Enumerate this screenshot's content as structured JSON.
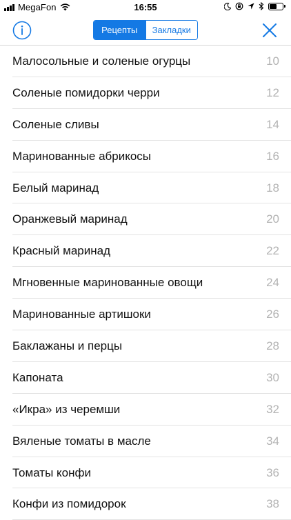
{
  "status_bar": {
    "carrier": "MegaFon",
    "time": "16:55"
  },
  "nav": {
    "info_icon": "info-circle-icon",
    "segments": [
      {
        "label": "Рецепты",
        "selected": true
      },
      {
        "label": "Закладки",
        "selected": false
      }
    ],
    "close_icon": "close-x-icon",
    "accent_color": "#1479e4"
  },
  "recipes": [
    {
      "title": "Малосольные и соленые огурцы",
      "page": "10"
    },
    {
      "title": "Соленые помидорки черри",
      "page": "12"
    },
    {
      "title": "Соленые сливы",
      "page": "14"
    },
    {
      "title": "Маринованные абрикосы",
      "page": "16"
    },
    {
      "title": "Белый маринад",
      "page": "18"
    },
    {
      "title": "Оранжевый маринад",
      "page": "20"
    },
    {
      "title": "Красный маринад",
      "page": "22"
    },
    {
      "title": "Мгновенные маринованные овощи",
      "page": "24"
    },
    {
      "title": "Маринованные артишоки",
      "page": "26"
    },
    {
      "title": "Баклажаны и перцы",
      "page": "28"
    },
    {
      "title": "Капоната",
      "page": "30"
    },
    {
      "title": "«Икра» из черемши",
      "page": "32"
    },
    {
      "title": "Вяленые томаты в масле",
      "page": "34"
    },
    {
      "title": "Томаты конфи",
      "page": "36"
    },
    {
      "title": "Конфи из помидорок",
      "page": "38"
    }
  ]
}
